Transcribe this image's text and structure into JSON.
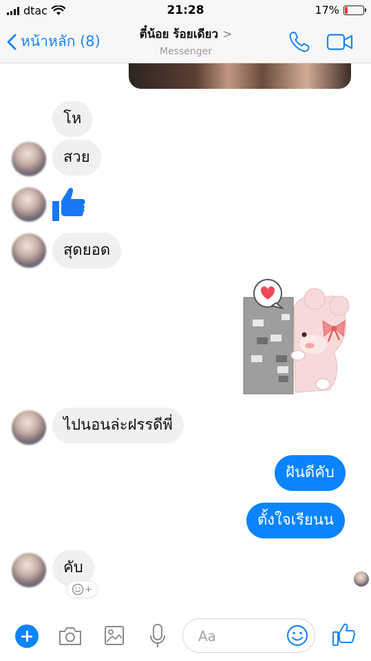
{
  "status_bar": {
    "carrier": "dtac",
    "time": "21:28",
    "battery_percent": "17%",
    "battery_level": 0.17
  },
  "header": {
    "back_label": "หน้าหลัก (8)",
    "contact_name": "ตี๋น้อย ร้อยเดียว",
    "subtitle": "Messenger",
    "chevron": ">"
  },
  "messages": [
    {
      "side": "in",
      "text": "โห"
    },
    {
      "side": "in",
      "text": "สวย"
    },
    {
      "side": "in",
      "type": "like-sticker"
    },
    {
      "side": "in",
      "text": "สุดยอด"
    },
    {
      "side": "out",
      "type": "sticker",
      "sticker_name": "bear-peeking-heart-sticker"
    },
    {
      "side": "in",
      "text": "ไปนอนล่ะฝรรดีพี่"
    },
    {
      "side": "out",
      "text": "ฝันดีคับ"
    },
    {
      "side": "out",
      "text": "ตั้งใจเรียนน"
    },
    {
      "side": "in",
      "text": "คับ"
    }
  ],
  "reaction_add": {
    "plus": "+"
  },
  "composer": {
    "placeholder": "Aa"
  },
  "colors": {
    "accent": "#0a84ff",
    "incoming_bubble": "#f0f0f0",
    "header_link": "#1b84f2"
  },
  "icons": [
    "signal-bars-icon",
    "wifi-icon",
    "battery-icon",
    "back-chevron-icon",
    "phone-icon",
    "video-camera-icon",
    "plus-icon",
    "camera-icon",
    "image-icon",
    "microphone-icon",
    "emoji-icon",
    "thumbs-up-icon"
  ]
}
